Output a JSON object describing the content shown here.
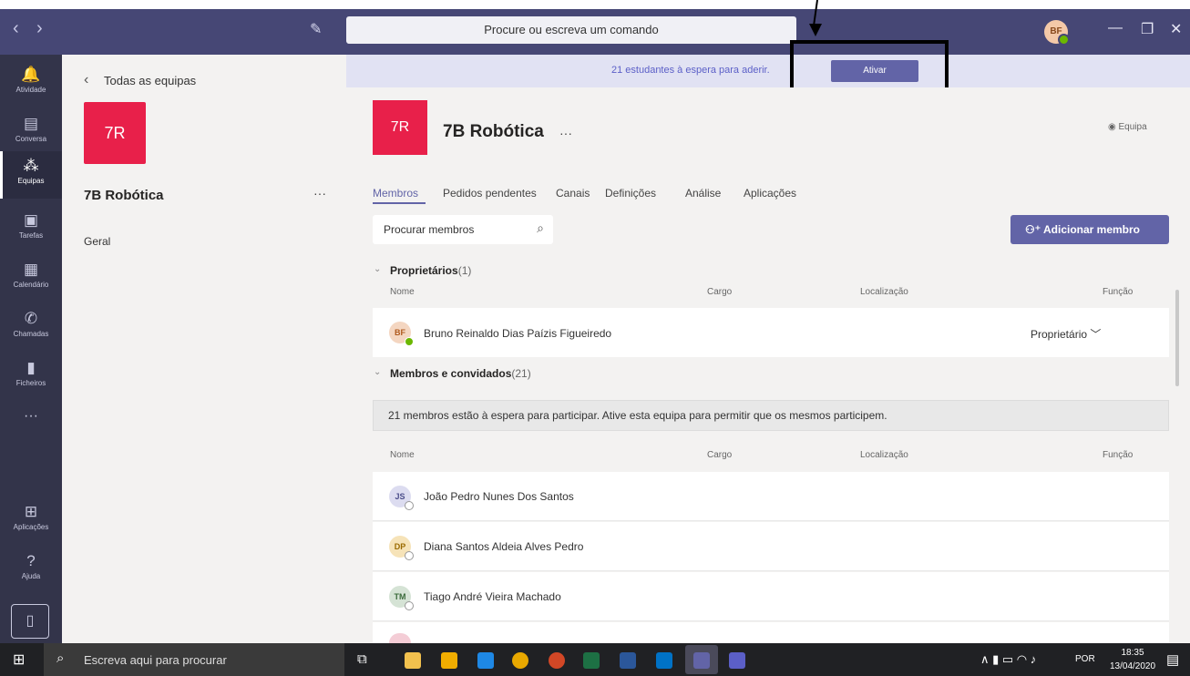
{
  "titlebar": {
    "back": "‹",
    "forward": "›",
    "search_placeholder": "Procure ou escreva um comando",
    "avatar": "BF",
    "minimize": "—",
    "maximize": "❐",
    "close": "✕"
  },
  "rail": {
    "items": [
      {
        "label": "Atividade",
        "icon": "bell-icon"
      },
      {
        "label": "Conversa",
        "icon": "chat-icon"
      },
      {
        "label": "Equipas",
        "icon": "teams-icon"
      },
      {
        "label": "Tarefas",
        "icon": "tasks-icon"
      },
      {
        "label": "Calendário",
        "icon": "calendar-icon"
      },
      {
        "label": "Chamadas",
        "icon": "phone-icon"
      },
      {
        "label": "Ficheiros",
        "icon": "file-icon"
      }
    ],
    "more": "···",
    "apps": "Aplicações",
    "help": "Ajuda"
  },
  "leftpane": {
    "back_label": "Todas as equipas",
    "team_initials": "7R",
    "team_name": "7B Robótica",
    "more": "···",
    "channel": "Geral"
  },
  "banner": {
    "text": "21 estudantes à espera para aderir.",
    "button": "Ativar"
  },
  "main": {
    "team_initials": "7R",
    "team_name": "7B Robótica",
    "more": "···",
    "team_badge": "Equipa",
    "tabs": [
      "Membros",
      "Pedidos pendentes",
      "Canais",
      "Definições",
      "Análise",
      "Aplicações"
    ],
    "search_placeholder": "Procurar membros",
    "add_member": "Adicionar membro",
    "owners_label": "Proprietários",
    "owners_count": "(1)",
    "columns": {
      "name": "Nome",
      "role": "Cargo",
      "location": "Localização",
      "function": "Função"
    },
    "owner": {
      "initials": "BF",
      "name": "Bruno Reinaldo Dias Paízis Figueiredo",
      "function": "Proprietário"
    },
    "members_label": "Membros e convidados",
    "members_count": "(21)",
    "notice": "21 membros estão à espera para participar. Ative esta equipa para permitir que os mesmos participem.",
    "members": [
      {
        "initials": "JS",
        "name": "João Pedro Nunes Dos Santos"
      },
      {
        "initials": "DP",
        "name": "Diana Santos Aldeia Alves Pedro"
      },
      {
        "initials": "TM",
        "name": "Tiago André Vieira Machado"
      }
    ]
  },
  "taskbar": {
    "search_placeholder": "Escreva aqui para procurar",
    "lang": "POR",
    "time": "18:35",
    "date": "13/04/2020"
  },
  "colors": {
    "accent": "#6264a7",
    "tile": "#e8204a",
    "header": "#464775",
    "rail": "#33344a"
  }
}
